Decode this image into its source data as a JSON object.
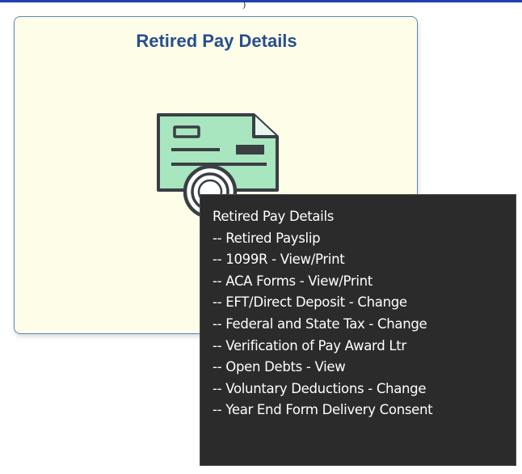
{
  "tile": {
    "title": "Retired Pay Details",
    "icon": "check-with-seal-icon",
    "colors": {
      "background": "#fefee8",
      "border": "#5b84c4",
      "title": "#264f8f",
      "check_fill": "#a8e6bf",
      "check_stroke": "#3a3f44"
    }
  },
  "tooltip": {
    "title": "Retired Pay Details",
    "items": [
      "-- Retired Payslip",
      "-- 1099R - View/Print",
      "-- ACA Forms - View/Print",
      "-- EFT/Direct Deposit - Change",
      "-- Federal and State Tax - Change",
      "-- Verification of Pay Award Ltr",
      "-- Open Debts - View",
      "-- Voluntary Deductions - Change",
      "-- Year End Form Delivery Consent"
    ],
    "colors": {
      "background": "#2b2b2b",
      "text": "#ffffff"
    }
  }
}
